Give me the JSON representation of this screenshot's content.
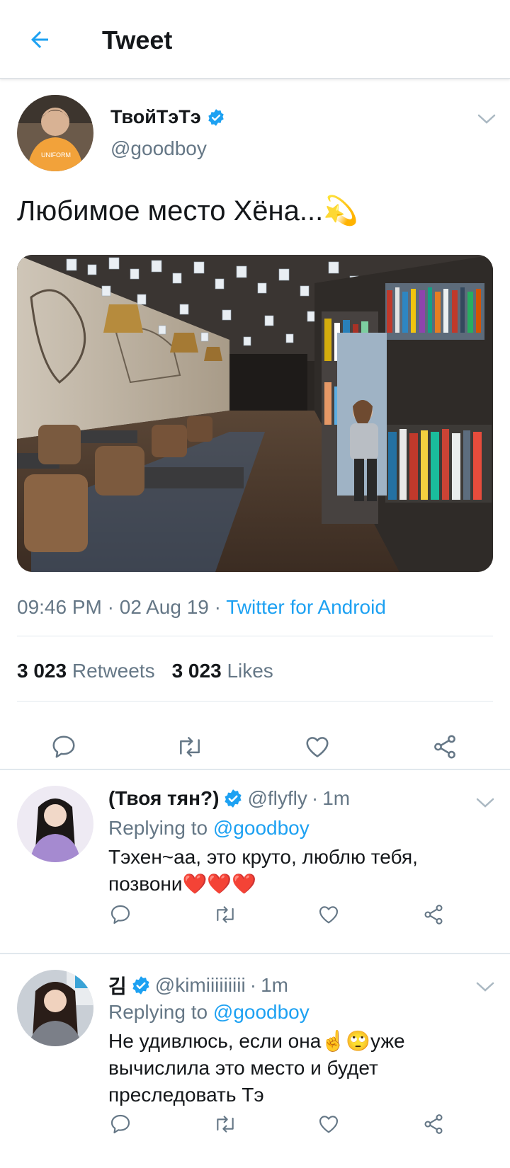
{
  "header": {
    "title": "Tweet"
  },
  "tweet": {
    "author_name": "ТвойТэТэ",
    "author_handle": "@goodboy",
    "text": "Любимое место Хёна...💫",
    "time": "09:46 PM",
    "date": "02 Aug 19",
    "source": "Twitter for Android",
    "retweet_count": "3 023",
    "retweet_label": "Retweets",
    "like_count": "3 023",
    "like_label": "Likes"
  },
  "replies": [
    {
      "name": "(Твоя тян?)",
      "handle": "@flyfly",
      "time": "1m",
      "replying_label": "Replying to",
      "replying_to": "@goodboy",
      "text": "Тэхен~аа, это круто, люблю тебя, позвони❤️❤️❤️"
    },
    {
      "name": "김",
      "handle": "@kimiiiiiiiii",
      "time": "1m",
      "replying_label": "Replying to",
      "replying_to": "@goodboy",
      "text": "Не удивлюсь, если она☝️🙄уже вычислила это место и будет преследовать Тэ"
    }
  ],
  "colors": {
    "accent": "#1da1f2",
    "secondary_text": "#657786",
    "divider": "#e1e8ed"
  }
}
